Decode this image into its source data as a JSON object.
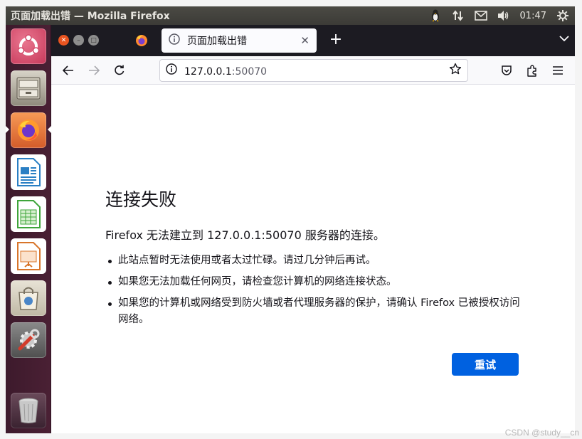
{
  "window": {
    "title": "页面加载出错 — Mozilla Firefox"
  },
  "panel": {
    "time": "01:47"
  },
  "launcher": {
    "items": [
      "ubuntu-dash",
      "files",
      "firefox",
      "libreoffice-writer",
      "libreoffice-calc",
      "libreoffice-impress",
      "ubuntu-software",
      "system-settings",
      "trash"
    ]
  },
  "tab": {
    "title": "页面加载出错"
  },
  "urlbar": {
    "host": "127.0.0.1",
    "port": ":50070"
  },
  "error": {
    "title": "连接失败",
    "description": "Firefox 无法建立到 127.0.0.1:50070 服务器的连接。",
    "bullets": [
      "此站点暂时无法使用或者太过忙碌。请过几分钟后再试。",
      "如果您无法加载任何网页，请检查您计算机的网络连接状态。",
      "如果您的计算机或网络受到防火墙或者代理服务器的保护，请确认 Firefox 已被授权访问网络。"
    ],
    "retry_label": "重试"
  },
  "watermark": "CSDN @study__cn",
  "colors": {
    "accent": "#0061e0",
    "launcher": "#4a2034",
    "firefox_chrome": "#1c1b22"
  }
}
